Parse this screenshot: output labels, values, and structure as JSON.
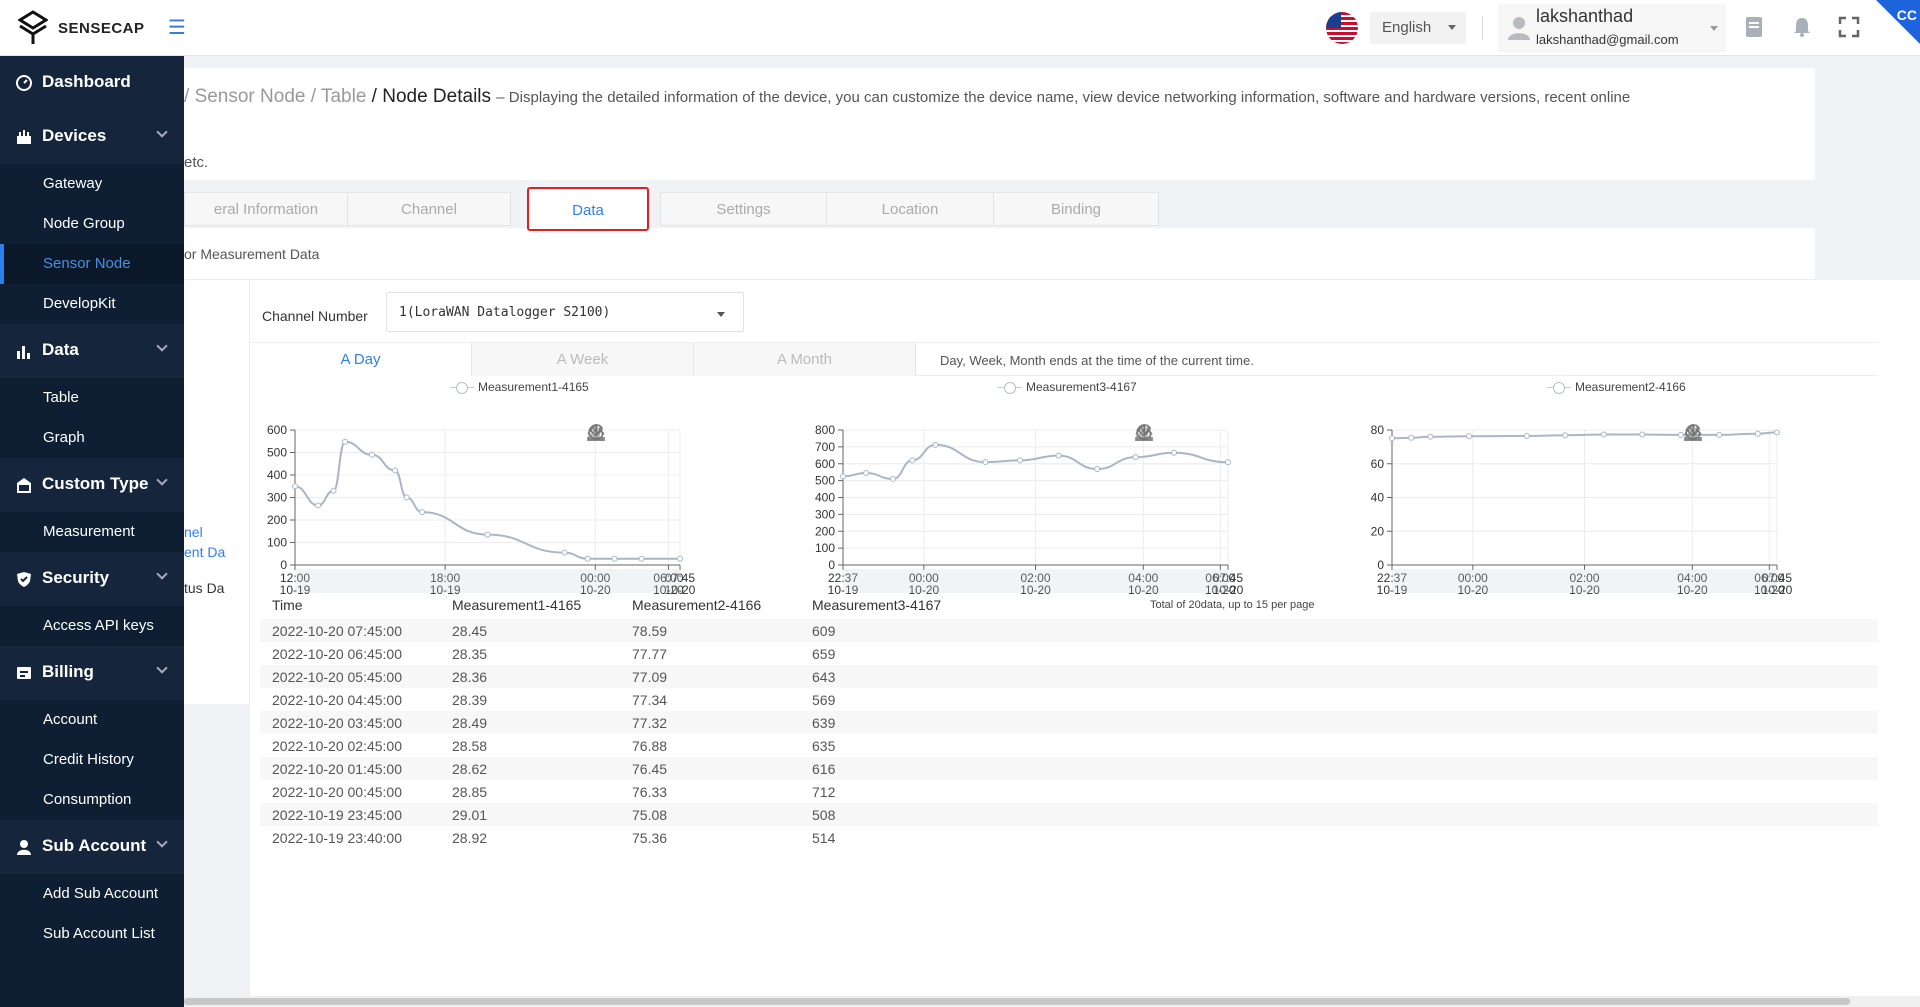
{
  "header": {
    "logo_text": "SENSECAP",
    "language": "English",
    "user_name": "lakshanthad",
    "user_email": "lakshanthad@gmail.com",
    "badge": "CC"
  },
  "sidebar": {
    "groups": [
      {
        "label": "Dashboard",
        "icon": "dashboard-icon"
      },
      {
        "label": "Devices",
        "icon": "devices-icon",
        "items": [
          "Gateway",
          "Node Group",
          "Sensor Node",
          "DevelopKit"
        ]
      },
      {
        "label": "Data",
        "icon": "bar-chart-icon",
        "items": [
          "Table",
          "Graph"
        ]
      },
      {
        "label": "Custom Type",
        "icon": "custom-type-icon",
        "items": [
          "Measurement"
        ]
      },
      {
        "label": "Security",
        "icon": "shield-icon",
        "items": [
          "Access API keys"
        ]
      },
      {
        "label": "Billing",
        "icon": "billing-icon",
        "items": [
          "Account",
          "Credit History",
          "Consumption"
        ]
      },
      {
        "label": "Sub Account",
        "icon": "user-icon",
        "items": [
          "Add Sub Account",
          "Sub Account List"
        ]
      }
    ],
    "active_item": "Sensor Node"
  },
  "breadcrumb": {
    "sep1": "/",
    "crumb1": "Sensor Node",
    "sep2": "/",
    "crumb2": "Table",
    "sep3": "/",
    "current": "Node Details",
    "description": "– Displaying the detailed information of the device, you can customize the device name, view device networking information, software and hardware versions, recent online",
    "description_cont": "etc."
  },
  "tabs": [
    {
      "label": "eral Information"
    },
    {
      "label": "Channel"
    },
    {
      "label": "Data",
      "active": true
    },
    {
      "label": "Settings"
    },
    {
      "label": "Location"
    },
    {
      "label": "Binding"
    }
  ],
  "sub_title": "or Measurement Data",
  "left_panel": {
    "item1a": "nel",
    "item1b": "ent Da",
    "item2": "tus Da"
  },
  "channel": {
    "label": "Channel Number",
    "value": "1(LoraWAN Datalogger S2100)"
  },
  "range_tabs": [
    "A Day",
    "A Week",
    "A Month"
  ],
  "range_note": "Day, Week, Month ends at the time of the current time.",
  "colors": {
    "accent": "#2f80ed",
    "sidebar_bg": "#0e1f33",
    "highlight_box": "#e02020",
    "series_line": "#a9b6c6"
  },
  "chart_data": [
    {
      "type": "line",
      "legend": "Measurement1-4165",
      "ylim": [
        0,
        600
      ],
      "yticks": [
        "600",
        "500",
        "400",
        "300",
        "200",
        "100",
        "0"
      ],
      "xtick_labels": [
        [
          "12:00",
          "10-19"
        ],
        [
          "18:00",
          "10-19"
        ],
        [
          "00:00",
          "10-20"
        ],
        [
          "06:00",
          "10-20"
        ],
        [
          "07:45",
          "10-20"
        ]
      ],
      "points": [
        [
          0.0,
          350
        ],
        [
          0.06,
          265
        ],
        [
          0.1,
          330
        ],
        [
          0.13,
          548
        ],
        [
          0.2,
          490
        ],
        [
          0.26,
          420
        ],
        [
          0.29,
          300
        ],
        [
          0.33,
          235
        ],
        [
          0.5,
          135
        ],
        [
          0.7,
          55
        ],
        [
          0.76,
          28
        ],
        [
          0.83,
          28
        ],
        [
          0.9,
          28
        ],
        [
          1.0,
          28
        ]
      ]
    },
    {
      "type": "line",
      "legend": "Measurement3-4167",
      "ylim": [
        0,
        800
      ],
      "yticks": [
        "800",
        "700",
        "600",
        "500",
        "400",
        "300",
        "200",
        "100",
        "0"
      ],
      "xtick_labels": [
        [
          "22:37",
          "10-19"
        ],
        [
          "00:00",
          "10-20"
        ],
        [
          "02:00",
          "10-20"
        ],
        [
          "04:00",
          "10-20"
        ],
        [
          "06:00",
          "10-20"
        ],
        [
          "07:45",
          "10-20"
        ]
      ],
      "points": [
        [
          0.0,
          525
        ],
        [
          0.06,
          545
        ],
        [
          0.13,
          510
        ],
        [
          0.18,
          620
        ],
        [
          0.24,
          712
        ],
        [
          0.37,
          610
        ],
        [
          0.46,
          620
        ],
        [
          0.56,
          648
        ],
        [
          0.66,
          569
        ],
        [
          0.76,
          639
        ],
        [
          0.86,
          665
        ],
        [
          1.0,
          609
        ]
      ]
    },
    {
      "type": "line",
      "legend": "Measurement2-4166",
      "ylim": [
        0,
        80
      ],
      "yticks": [
        "80",
        "60",
        "40",
        "20",
        "0"
      ],
      "xtick_labels": [
        [
          "22:37",
          "10-19"
        ],
        [
          "00:00",
          "10-20"
        ],
        [
          "02:00",
          "10-20"
        ],
        [
          "04:00",
          "10-20"
        ],
        [
          "06:00",
          "10-20"
        ],
        [
          "07:45",
          "10-20"
        ]
      ],
      "points": [
        [
          0.0,
          75.1
        ],
        [
          0.05,
          75.4
        ],
        [
          0.1,
          76.0
        ],
        [
          0.2,
          76.3
        ],
        [
          0.35,
          76.5
        ],
        [
          0.45,
          76.9
        ],
        [
          0.55,
          77.3
        ],
        [
          0.65,
          77.3
        ],
        [
          0.75,
          77.1
        ],
        [
          0.85,
          77.1
        ],
        [
          0.95,
          77.8
        ],
        [
          1.0,
          78.6
        ]
      ]
    }
  ],
  "table": {
    "headers": [
      "Time",
      "Measurement1-4165",
      "Measurement2-4166",
      "Measurement3-4167"
    ],
    "total_text": "Total of 20data, up to 15 per page",
    "rows": [
      [
        "2022-10-20 07:45:00",
        "28.45",
        "78.59",
        "609"
      ],
      [
        "2022-10-20 06:45:00",
        "28.35",
        "77.77",
        "659"
      ],
      [
        "2022-10-20 05:45:00",
        "28.36",
        "77.09",
        "643"
      ],
      [
        "2022-10-20 04:45:00",
        "28.39",
        "77.34",
        "569"
      ],
      [
        "2022-10-20 03:45:00",
        "28.49",
        "77.32",
        "639"
      ],
      [
        "2022-10-20 02:45:00",
        "28.58",
        "76.88",
        "635"
      ],
      [
        "2022-10-20 01:45:00",
        "28.62",
        "76.45",
        "616"
      ],
      [
        "2022-10-20 00:45:00",
        "28.85",
        "76.33",
        "712"
      ],
      [
        "2022-10-19 23:45:00",
        "29.01",
        "75.08",
        "508"
      ],
      [
        "2022-10-19 23:40:00",
        "28.92",
        "75.36",
        "514"
      ]
    ]
  }
}
